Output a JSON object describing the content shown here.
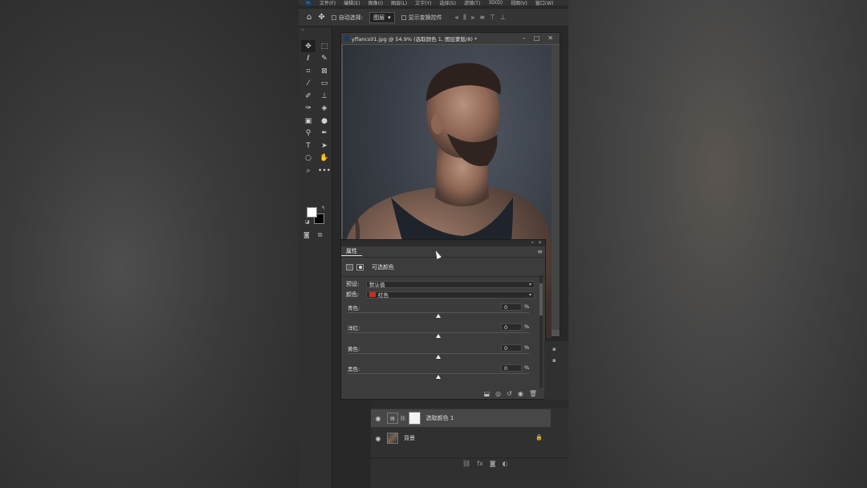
{
  "menubar": {
    "items": [
      "文件(F)",
      "编辑(E)",
      "图像(I)",
      "图层(L)",
      "文字(Y)",
      "选择(S)",
      "滤镜(T)",
      "3D(D)",
      "视图(V)",
      "窗口(W)"
    ]
  },
  "options": {
    "auto_select_label": "自动选择:",
    "auto_select_target": "图层",
    "transform_controls_label": "显示变换控件"
  },
  "document": {
    "title": "yffancs01.jpg @ 54.9% (选取颜色 1, 图层蒙版/8) *"
  },
  "properties": {
    "tab_label": "属性",
    "adjustment_name": "可选颜色",
    "preset_label": "预设:",
    "preset_value": "默认值",
    "colors_label": "颜色:",
    "colors_value": "红色",
    "colors_swatch": "#d12a1a",
    "sliders": [
      {
        "label": "青色:",
        "value": "0",
        "unit": "%",
        "position": 0.5
      },
      {
        "label": "洋红:",
        "value": "0",
        "unit": "%",
        "position": 0.5
      },
      {
        "label": "黄色:",
        "value": "0",
        "unit": "%",
        "position": 0.5
      },
      {
        "label": "黑色:",
        "value": "0",
        "unit": "%",
        "position": 0.5
      }
    ]
  },
  "layers": {
    "items": [
      {
        "name": "选取颜色 1",
        "selected": true
      },
      {
        "name": "背景",
        "selected": false
      }
    ]
  }
}
